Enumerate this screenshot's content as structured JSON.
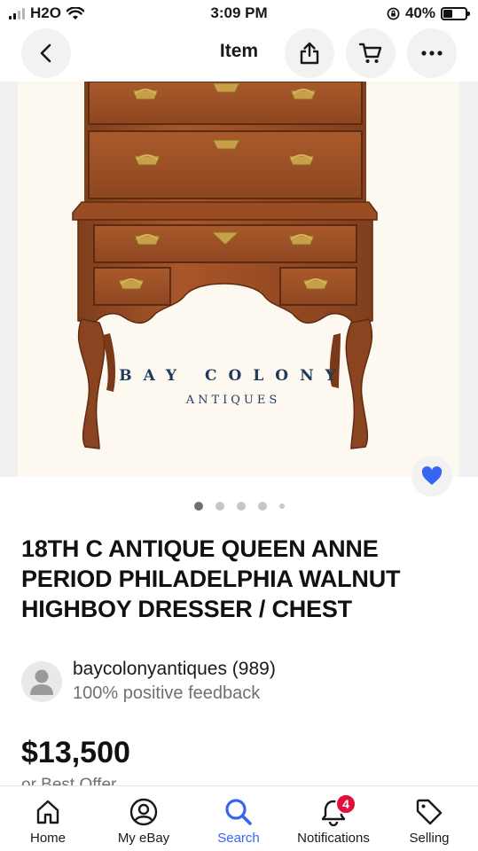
{
  "status_bar": {
    "carrier": "H2O",
    "time": "3:09 PM",
    "battery": "40%",
    "battery_level": 0.4
  },
  "header": {
    "title": "Item",
    "back_icon": "chevron-left-icon",
    "share_icon": "share-icon",
    "cart_icon": "cart-icon",
    "more_icon": "more-horizontal-icon"
  },
  "gallery": {
    "watermark_line1": "BAY COLONY",
    "watermark_line2": "ANTIQUES",
    "image_count": 5,
    "current_index": 1,
    "favorited": true,
    "accent_color": "#3665f3"
  },
  "item": {
    "title": "18TH C ANTIQUE QUEEN ANNE PERIOD PHILADELPHIA WALNUT HIGHBOY DRESSER / CHEST"
  },
  "seller": {
    "name_line": "baycolonyantiques (989)",
    "feedback": "100% positive feedback"
  },
  "pricing": {
    "price": "$13,500",
    "best_offer": "or Best Offer"
  },
  "tabbar": {
    "items": [
      {
        "label": "Home",
        "icon": "home-icon"
      },
      {
        "label": "My eBay",
        "icon": "profile-icon"
      },
      {
        "label": "Search",
        "icon": "search-icon",
        "active": true
      },
      {
        "label": "Notifications",
        "icon": "bell-icon",
        "badge": "4"
      },
      {
        "label": "Selling",
        "icon": "tag-icon"
      }
    ]
  }
}
